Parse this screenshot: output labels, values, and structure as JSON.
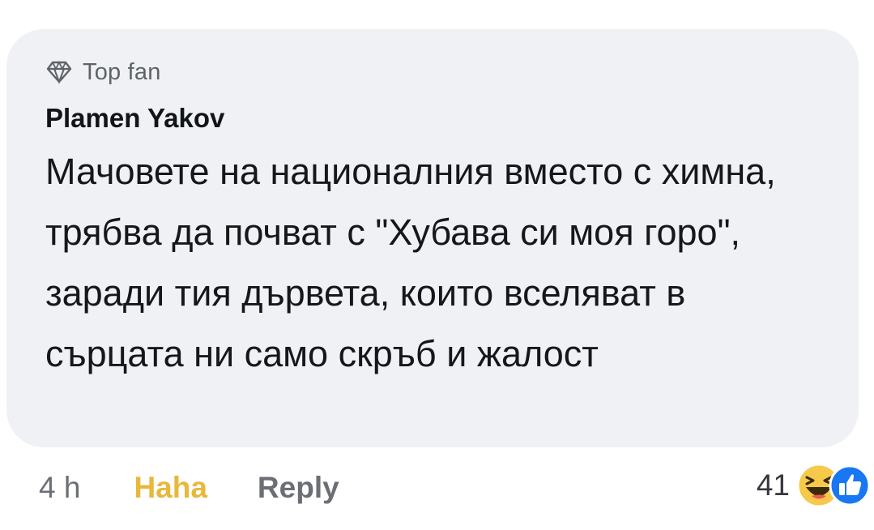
{
  "comment": {
    "badge": {
      "icon": "diamond-icon",
      "label": "Top fan"
    },
    "author": "Plamen Yakov",
    "text": "Мачовете на националния вместо с химна, трябва да почват с \"Хубава си моя горо\", заради тия дървета, които вселяват в сърцата ни само скръб и жалост",
    "time": "4 h",
    "reaction_button": "Haha",
    "reply_button": "Reply",
    "reaction_count": "41",
    "reaction_icons": [
      "haha-emoji-icon",
      "like-thumb-icon"
    ]
  },
  "colors": {
    "bubble_background": "#eff1f5",
    "haha_label": "#e8b83b",
    "secondary_text": "#6b6f75",
    "like_blue": "#1877f2",
    "haha_yellow": "#f7c94b"
  }
}
